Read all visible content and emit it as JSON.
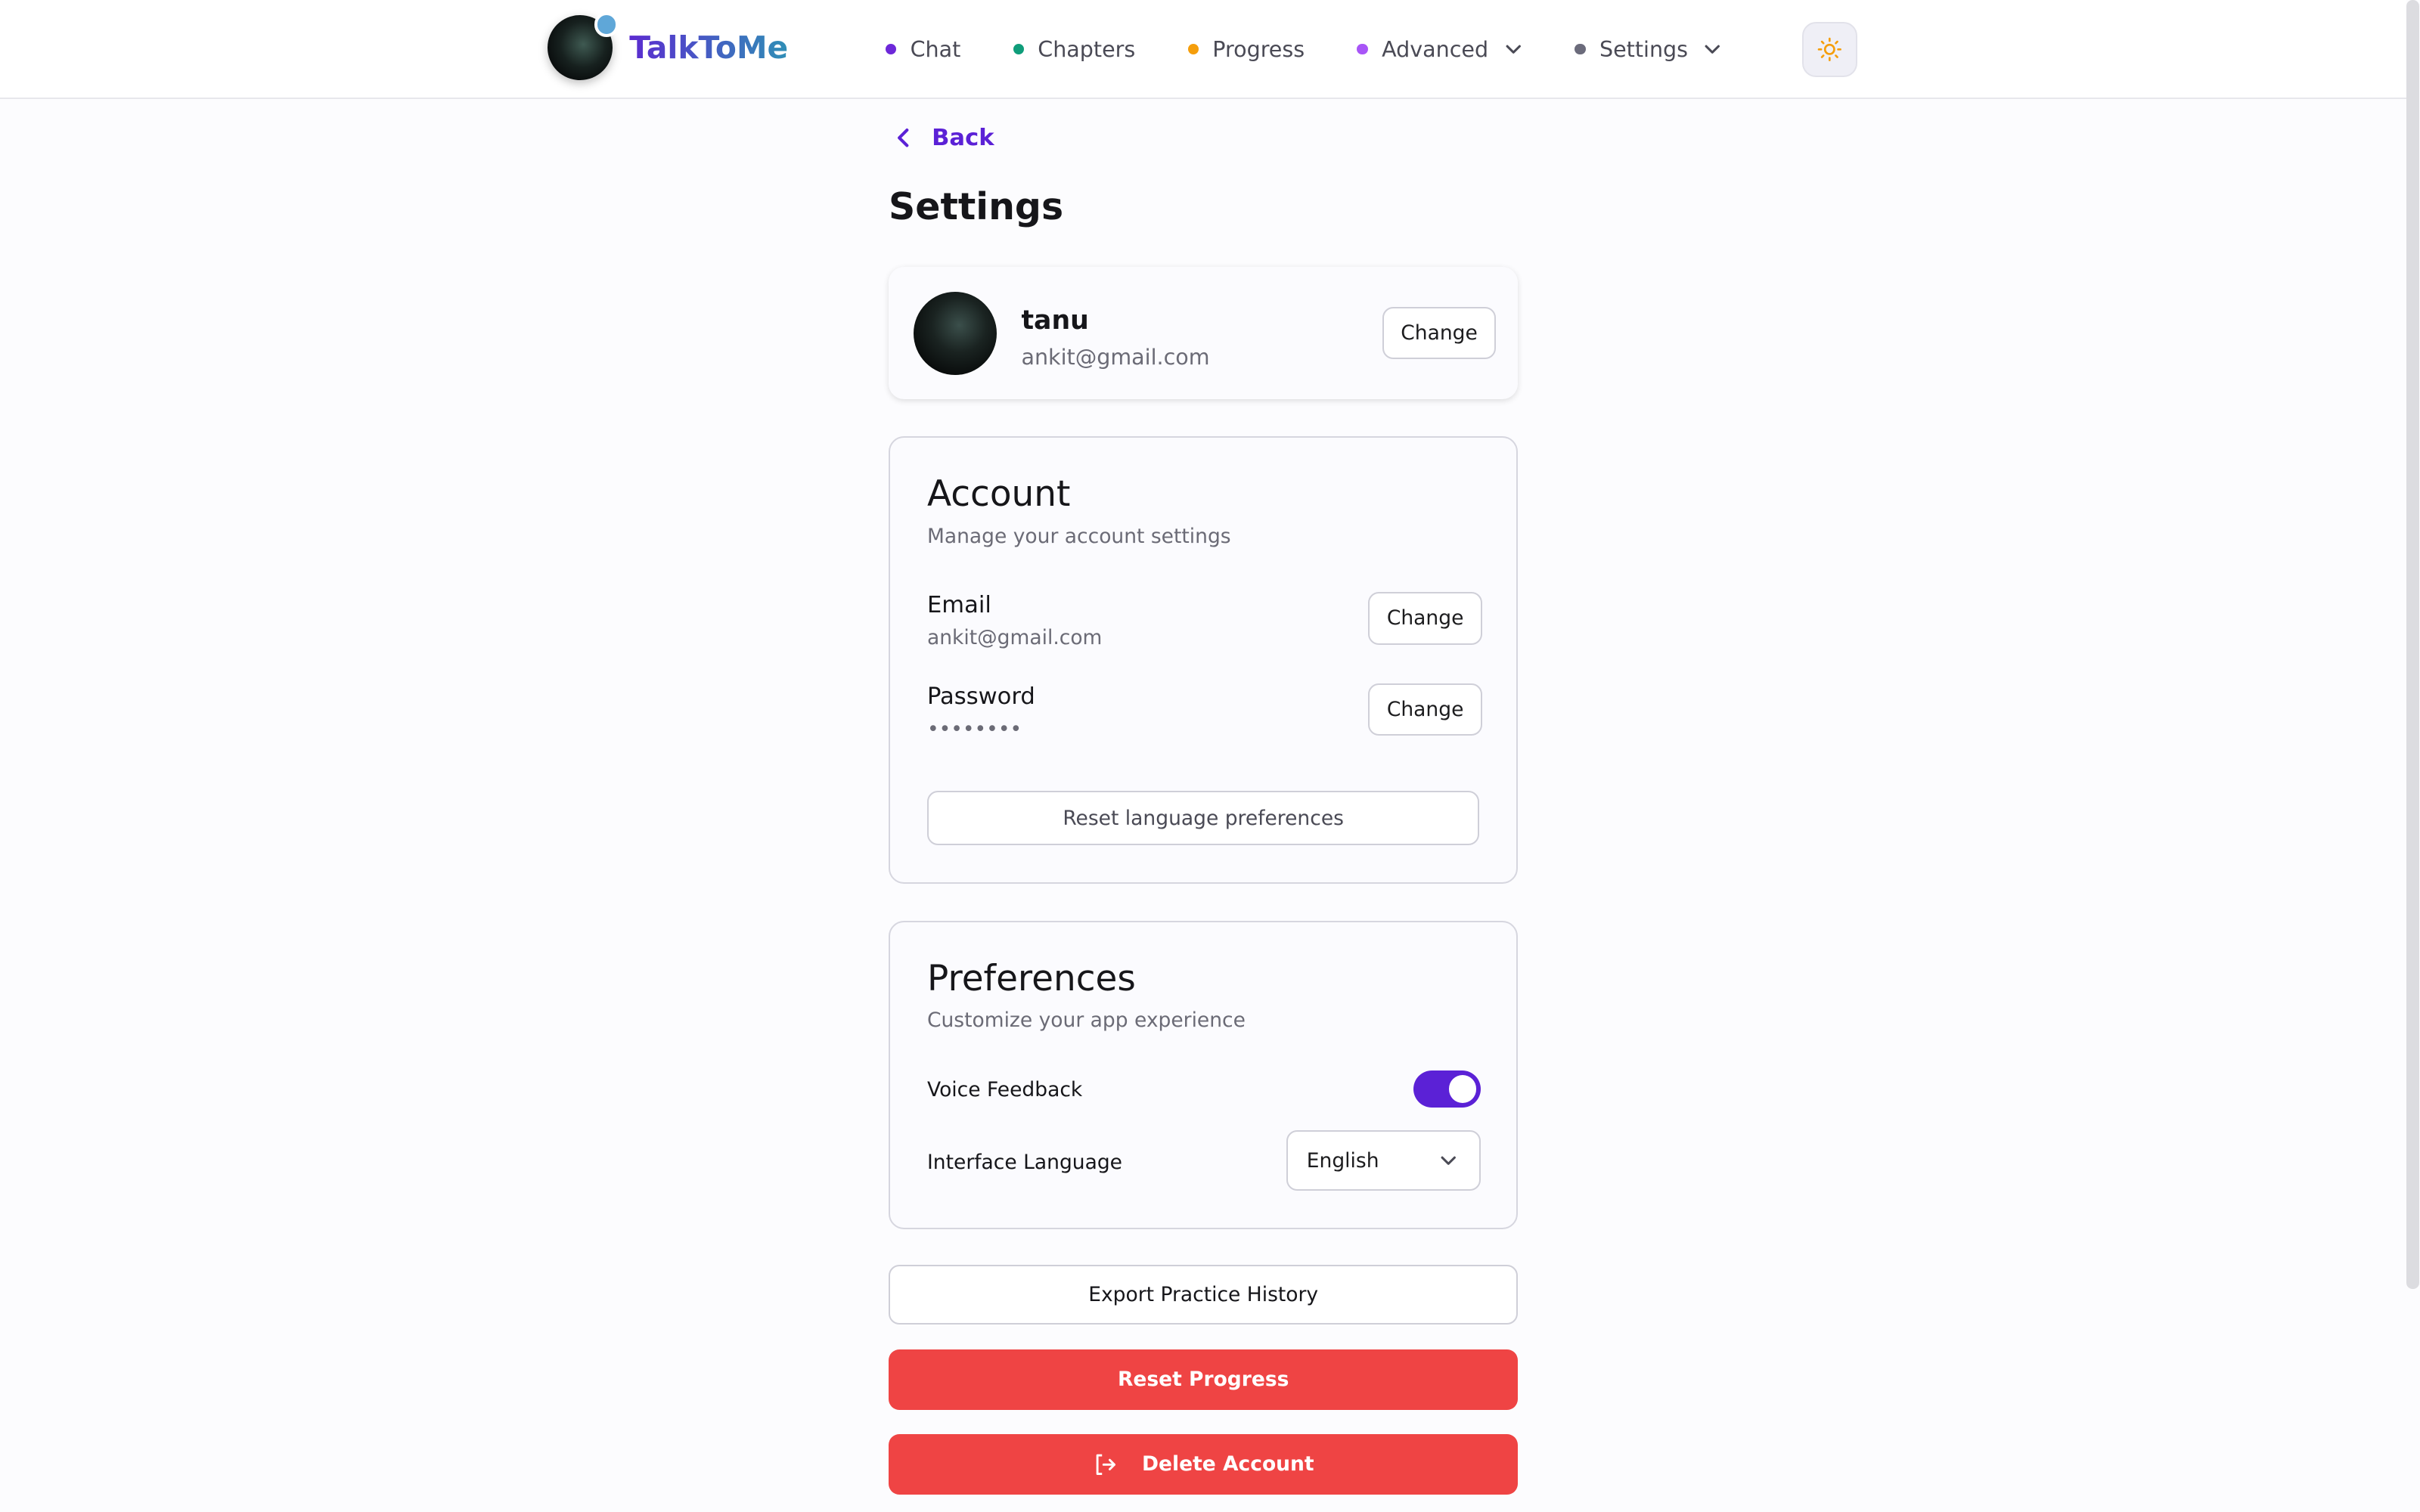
{
  "brand": {
    "name": "TalkToMe"
  },
  "nav": {
    "items": [
      {
        "label": "Chat",
        "dot_color": "#6d28d9"
      },
      {
        "label": "Chapters",
        "dot_color": "#0f9d7a"
      },
      {
        "label": "Progress",
        "dot_color": "#f59e0b"
      },
      {
        "label": "Advanced",
        "dot_color": "#a855f7"
      },
      {
        "label": "Settings",
        "dot_color": "#6b6b7b"
      }
    ]
  },
  "header": {
    "theme_icon": "sun-icon"
  },
  "page": {
    "back_label": "Back",
    "title": "Settings"
  },
  "profile": {
    "name": "tanu",
    "email": "ankit@gmail.com",
    "change_label": "Change"
  },
  "account": {
    "title": "Account",
    "subtitle": "Manage your account settings",
    "email_label": "Email",
    "email_value": "ankit@gmail.com",
    "password_label": "Password",
    "password_value": "••••••••",
    "change_label": "Change",
    "reset_lang_label": "Reset language preferences"
  },
  "preferences": {
    "title": "Preferences",
    "subtitle": "Customize your app experience",
    "voice_label": "Voice Feedback",
    "voice_enabled": true,
    "language_label": "Interface Language",
    "language_value": "English"
  },
  "actions": {
    "export_label": "Export Practice History",
    "reset_progress_label": "Reset Progress",
    "delete_label": "Delete Account"
  },
  "colors": {
    "accent": "#5b21d6",
    "danger": "#ef4444"
  }
}
